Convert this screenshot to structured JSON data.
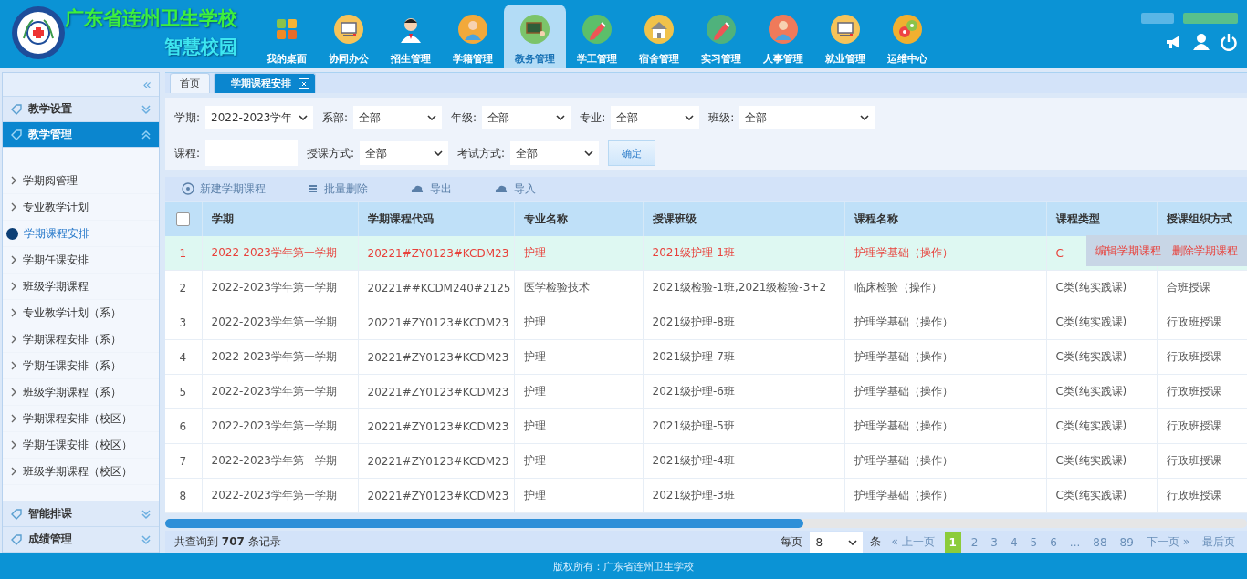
{
  "header": {
    "school_name": "广东省连州卫生学校",
    "subtitle": "智慧校园",
    "nav": [
      {
        "label": "我的桌面",
        "selected": false
      },
      {
        "label": "协同办公",
        "selected": false
      },
      {
        "label": "招生管理",
        "selected": false
      },
      {
        "label": "学籍管理",
        "selected": false
      },
      {
        "label": "教务管理",
        "selected": true
      },
      {
        "label": "学工管理",
        "selected": false
      },
      {
        "label": "宿舍管理",
        "selected": false
      },
      {
        "label": "实习管理",
        "selected": false
      },
      {
        "label": "人事管理",
        "selected": false
      },
      {
        "label": "就业管理",
        "selected": false
      },
      {
        "label": "运维中心",
        "selected": false
      }
    ]
  },
  "sidebar": {
    "collapse": "«",
    "groups": [
      {
        "label": "教学设置",
        "expanded": false,
        "selected": false
      },
      {
        "label": "教学管理",
        "expanded": true,
        "selected": true,
        "items": [
          {
            "label": "学期阅管理",
            "selected": false
          },
          {
            "label": "专业教学计划",
            "selected": false
          },
          {
            "label": "学期课程安排",
            "selected": true
          },
          {
            "label": "学期任课安排",
            "selected": false
          },
          {
            "label": "班级学期课程",
            "selected": false
          },
          {
            "label": "专业教学计划（系）",
            "selected": false
          },
          {
            "label": "学期课程安排（系）",
            "selected": false
          },
          {
            "label": "学期任课安排（系）",
            "selected": false
          },
          {
            "label": "班级学期课程（系）",
            "selected": false
          },
          {
            "label": "学期课程安排（校区）",
            "selected": false
          },
          {
            "label": "学期任课安排（校区）",
            "selected": false
          },
          {
            "label": "班级学期课程（校区）",
            "selected": false
          }
        ]
      },
      {
        "label": "智能排课",
        "expanded": false,
        "selected": false
      },
      {
        "label": "成绩管理",
        "expanded": false,
        "selected": false
      }
    ]
  },
  "tabs": [
    {
      "label": "首页",
      "selected": false,
      "closable": false
    },
    {
      "label": "学期课程安排",
      "selected": true,
      "closable": true
    }
  ],
  "filters": [
    [
      {
        "label": "学期:",
        "kind": "select",
        "value": "2022-2023学年"
      },
      {
        "label": "系部:",
        "kind": "select",
        "value": "全部"
      },
      {
        "label": "年级:",
        "kind": "select",
        "value": "全部"
      },
      {
        "label": "专业:",
        "kind": "select",
        "value": "全部"
      },
      {
        "label": "班级:",
        "kind": "select",
        "value": "全部"
      }
    ],
    [
      {
        "label": "课程:",
        "kind": "input"
      },
      {
        "label": "授课方式:",
        "kind": "select",
        "value": "全部"
      },
      {
        "label": "考试方式:",
        "kind": "select",
        "value": "全部"
      },
      {
        "label": "确定",
        "kind": "button"
      }
    ]
  ],
  "toolbar": [
    "新建学期课程",
    "批量删除",
    "导出",
    "导入"
  ],
  "table": {
    "select_all_checked": false,
    "columns": [
      "学期",
      "学期课程代码",
      "专业名称",
      "授课班级",
      "课程名称",
      "课程类型",
      "授课组织方式"
    ],
    "rows": [
      {
        "no": "1",
        "selected": true,
        "cells": [
          "2022-2023学年第一学期",
          "20221#ZY0123#KCDM23",
          "护理",
          "2021级护理-1班",
          "护理学基础（操作）",
          "C"
        ],
        "actions": [
          "编辑学期课程",
          "删除学期课程"
        ]
      },
      {
        "no": "2",
        "selected": false,
        "cells": [
          "2022-2023学年第一学期",
          "20221##KCDM240#2125",
          "医学检验技术",
          "2021级检验-1班,2021级检验-3+2",
          "临床检验（操作）",
          "C类(纯实践课)",
          "合班授课"
        ]
      },
      {
        "no": "3",
        "selected": false,
        "cells": [
          "2022-2023学年第一学期",
          "20221#ZY0123#KCDM23",
          "护理",
          "2021级护理-8班",
          "护理学基础（操作）",
          "C类(纯实践课)",
          "行政班授课"
        ]
      },
      {
        "no": "4",
        "selected": false,
        "cells": [
          "2022-2023学年第一学期",
          "20221#ZY0123#KCDM23",
          "护理",
          "2021级护理-7班",
          "护理学基础（操作）",
          "C类(纯实践课)",
          "行政班授课"
        ]
      },
      {
        "no": "5",
        "selected": false,
        "cells": [
          "2022-2023学年第一学期",
          "20221#ZY0123#KCDM23",
          "护理",
          "2021级护理-6班",
          "护理学基础（操作）",
          "C类(纯实践课)",
          "行政班授课"
        ]
      },
      {
        "no": "6",
        "selected": false,
        "cells": [
          "2022-2023学年第一学期",
          "20221#ZY0123#KCDM23",
          "护理",
          "2021级护理-5班",
          "护理学基础（操作）",
          "C类(纯实践课)",
          "行政班授课"
        ]
      },
      {
        "no": "7",
        "selected": false,
        "cells": [
          "2022-2023学年第一学期",
          "20221#ZY0123#KCDM23",
          "护理",
          "2021级护理-4班",
          "护理学基础（操作）",
          "C类(纯实践课)",
          "行政班授课"
        ]
      },
      {
        "no": "8",
        "selected": false,
        "cells": [
          "2022-2023学年第一学期",
          "20221#ZY0123#KCDM23",
          "护理",
          "2021级护理-3班",
          "护理学基础（操作）",
          "C类(纯实践课)",
          "行政班授课"
        ]
      }
    ]
  },
  "pagination": {
    "summary": "共查询到 **707** 条记录",
    "per_page_label": "每页",
    "per_page": "8",
    "per_page_unit": "条",
    "prev": "« 上一页",
    "pages": [
      {
        "label": "1",
        "selected": true
      },
      {
        "label": "2",
        "selected": false
      },
      {
        "label": "3",
        "selected": false
      },
      {
        "label": "4",
        "selected": false
      },
      {
        "label": "5",
        "selected": false
      },
      {
        "label": "6",
        "selected": false
      },
      {
        "label": "...",
        "selected": false
      },
      {
        "label": "88",
        "selected": false
      },
      {
        "label": "89",
        "selected": false
      }
    ],
    "next": "下一页 »",
    "last": "最后页"
  },
  "footer": "版权所有：广东省连州卫生学校"
}
